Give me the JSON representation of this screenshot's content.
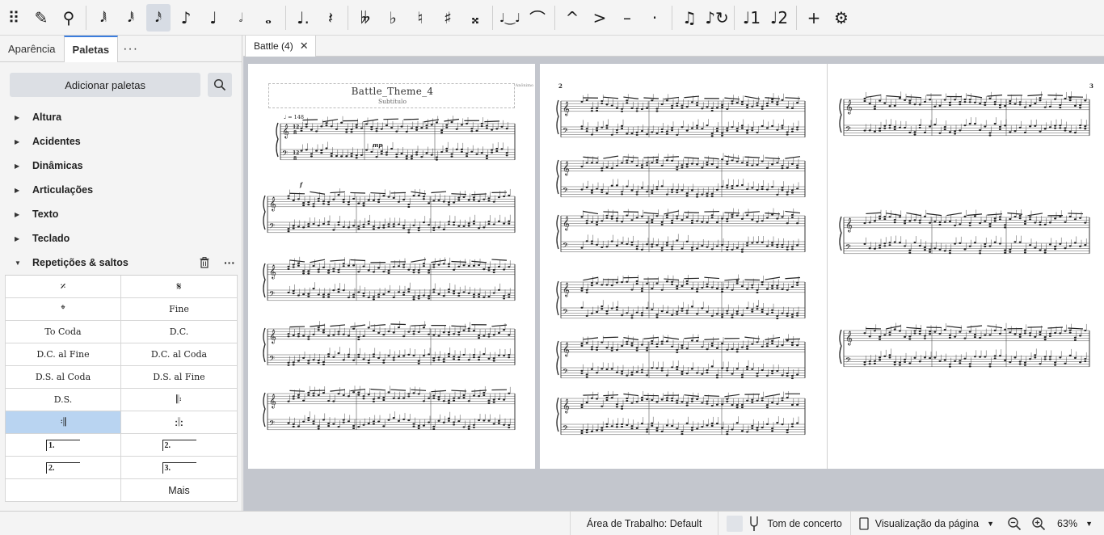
{
  "toolbar": {
    "items": [
      {
        "name": "drag-handle-icon",
        "glyph": "⠿",
        "active": false
      },
      {
        "name": "note-input-pencil-icon",
        "glyph": "✎",
        "active": false
      },
      {
        "name": "input-mode-pin-icon",
        "glyph": "⚲",
        "active": false
      },
      {
        "name": "sep"
      },
      {
        "name": "note-64th-icon",
        "glyph": "𝅘𝅥𝅲",
        "active": false
      },
      {
        "name": "note-32nd-icon",
        "glyph": "𝅘𝅥𝅱",
        "active": false
      },
      {
        "name": "note-16th-icon",
        "glyph": "𝅘𝅥𝅰",
        "active": true
      },
      {
        "name": "note-eighth-icon",
        "glyph": "♪",
        "active": false
      },
      {
        "name": "note-quarter-icon",
        "glyph": "♩",
        "active": false
      },
      {
        "name": "note-half-icon",
        "glyph": "𝅗𝅥",
        "active": false
      },
      {
        "name": "note-whole-icon",
        "glyph": "𝅝",
        "active": false
      },
      {
        "name": "sep"
      },
      {
        "name": "augmentation-dot-icon",
        "glyph": "♩.",
        "active": false
      },
      {
        "name": "rest-icon",
        "glyph": "𝄽",
        "active": false
      },
      {
        "name": "sep"
      },
      {
        "name": "double-flat-icon",
        "glyph": "𝄫",
        "active": false
      },
      {
        "name": "flat-icon",
        "glyph": "♭",
        "active": false
      },
      {
        "name": "natural-icon",
        "glyph": "♮",
        "active": false
      },
      {
        "name": "sharp-icon",
        "glyph": "♯",
        "active": false
      },
      {
        "name": "double-sharp-icon",
        "glyph": "𝄪",
        "active": false
      },
      {
        "name": "sep"
      },
      {
        "name": "tie-icon",
        "glyph": "♩‿♩",
        "active": false
      },
      {
        "name": "slur-icon",
        "glyph": "⌒",
        "active": false
      },
      {
        "name": "sep"
      },
      {
        "name": "marcato-icon",
        "glyph": "^",
        "active": false
      },
      {
        "name": "accent-icon",
        "glyph": ">",
        "active": false
      },
      {
        "name": "tenuto-icon",
        "glyph": "–",
        "active": false
      },
      {
        "name": "staccato-icon",
        "glyph": "·",
        "active": false
      },
      {
        "name": "sep"
      },
      {
        "name": "tuplet-icon",
        "glyph": "♫",
        "active": false
      },
      {
        "name": "flip-direction-icon",
        "glyph": "♪↻",
        "active": false
      },
      {
        "name": "sep"
      },
      {
        "name": "voice-1-icon",
        "glyph": "♩1",
        "active": false
      },
      {
        "name": "voice-2-icon",
        "glyph": "♩2",
        "active": false
      },
      {
        "name": "sep"
      },
      {
        "name": "add-icon",
        "glyph": "+",
        "active": false
      },
      {
        "name": "settings-gear-icon",
        "glyph": "⚙",
        "active": false
      }
    ]
  },
  "panel": {
    "tabs": [
      {
        "label": "Aparência",
        "active": false
      },
      {
        "label": "Paletas",
        "active": true
      }
    ],
    "more": "···",
    "add_palettes": "Adicionar paletas",
    "categories": [
      "Altura",
      "Acidentes",
      "Dinâmicas",
      "Articulações",
      "Texto",
      "Teclado"
    ],
    "expanded": "Repetições & saltos",
    "palette_cells": [
      {
        "label": "𝄎",
        "kind": "sym"
      },
      {
        "label": "𝄋",
        "kind": "sym"
      },
      {
        "label": "𝄌",
        "kind": "sym"
      },
      {
        "label": "Fine",
        "kind": "text"
      },
      {
        "label": "To Coda",
        "kind": "text"
      },
      {
        "label": "D.C.",
        "kind": "text"
      },
      {
        "label": "D.C. al Fine",
        "kind": "text"
      },
      {
        "label": "D.C. al Coda",
        "kind": "text"
      },
      {
        "label": "D.S. al Coda",
        "kind": "text"
      },
      {
        "label": "D.S. al Fine",
        "kind": "text"
      },
      {
        "label": "D.S.",
        "kind": "text"
      },
      {
        "label": "𝄆",
        "kind": "sym"
      },
      {
        "label": "𝄇",
        "kind": "sym",
        "selected": true
      },
      {
        "label": ":𝄁:",
        "kind": "sym"
      },
      {
        "label": "1.",
        "kind": "volta"
      },
      {
        "label": "2.",
        "kind": "volta"
      },
      {
        "label": "2.",
        "kind": "volta"
      },
      {
        "label": "3.",
        "kind": "volta"
      },
      {
        "label": "",
        "kind": "text"
      },
      {
        "label": "Mais",
        "kind": "mais"
      }
    ]
  },
  "doc_tab": {
    "label": "Battle (4)",
    "close": "✕"
  },
  "score": {
    "title": "Battle_Theme_4",
    "subtitle": "Subtítulo",
    "composer": "Anônimo",
    "tempo": "♩ = 148",
    "time_signature": "12/8",
    "dynamics": [
      "mp",
      "f"
    ],
    "page_numbers": [
      "2",
      "3"
    ]
  },
  "status": {
    "workspace": "Área de Trabalho: Default",
    "concert_pitch": "Tom de concerto",
    "view_mode": "Visualização da página",
    "zoom": "63%"
  },
  "colors": {
    "accent": "#3b7ddd",
    "selected_cell": "#b9d4f1",
    "canvas_bg": "#c3c6cd"
  }
}
